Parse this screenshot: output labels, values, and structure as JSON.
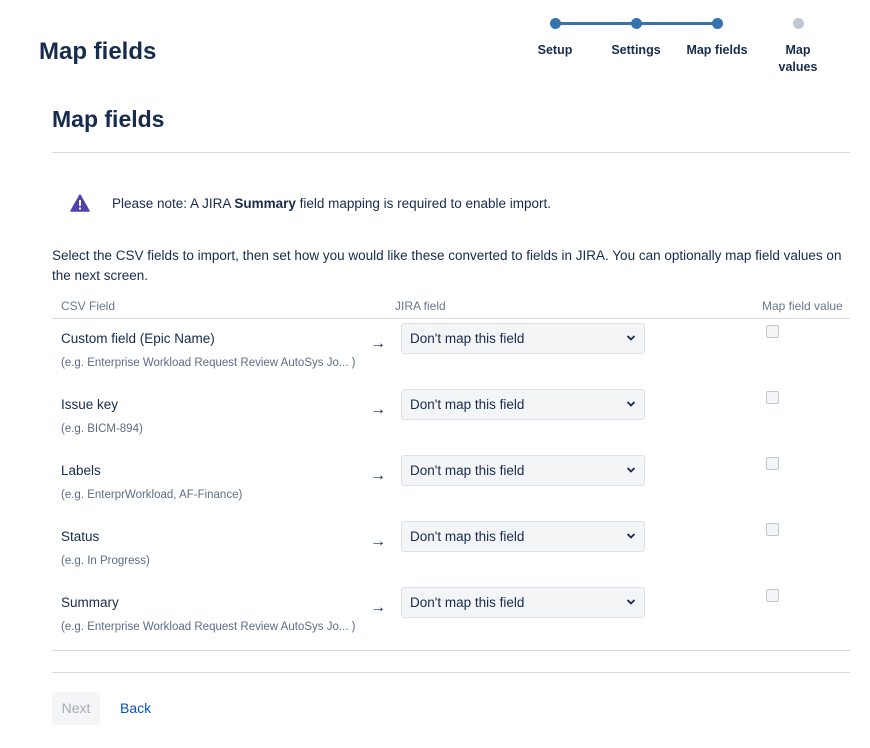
{
  "header": {
    "title": "Map fields"
  },
  "progress": {
    "steps": [
      {
        "label": "Setup",
        "state": "done"
      },
      {
        "label": "Settings",
        "state": "done"
      },
      {
        "label": "Map fields",
        "state": "current"
      },
      {
        "label": "Map values",
        "state": "todo"
      }
    ]
  },
  "section": {
    "title": "Map fields"
  },
  "warning": {
    "icon": "warning-icon",
    "prefix": "Please note: A JIRA ",
    "bold": "Summary",
    "suffix": " field mapping is required to enable import."
  },
  "intro": "Select the CSV fields to import, then set how you would like these converted to fields in JIRA. You can optionally map field values on the next screen.",
  "table": {
    "headers": {
      "csv": "CSV Field",
      "jira": "JIRA field",
      "map": "Map field value"
    },
    "rows": [
      {
        "name": "Custom field (Epic Name)",
        "example": "(e.g.  Enterprise Workload Request Review AutoSys Jo... )",
        "select": "Don't map this field",
        "checked": false
      },
      {
        "name": "Issue key",
        "example": "(e.g.  BICM-894)",
        "select": "Don't map this field",
        "checked": false
      },
      {
        "name": "Labels",
        "example": "(e.g.  EnterprWorkload, AF-Finance)",
        "select": "Don't map this field",
        "checked": false
      },
      {
        "name": "Status",
        "example": "(e.g.  In Progress)",
        "select": "Don't map this field",
        "checked": false
      },
      {
        "name": "Summary",
        "example": "(e.g.  Enterprise Workload Request Review AutoSys Jo... )",
        "select": "Don't map this field",
        "checked": false
      }
    ],
    "arrow": "→"
  },
  "footer": {
    "next_label": "Next",
    "back_label": "Back"
  },
  "colors": {
    "accent": "#3572b0",
    "warning": "#5243aa",
    "link": "#0052cc"
  }
}
